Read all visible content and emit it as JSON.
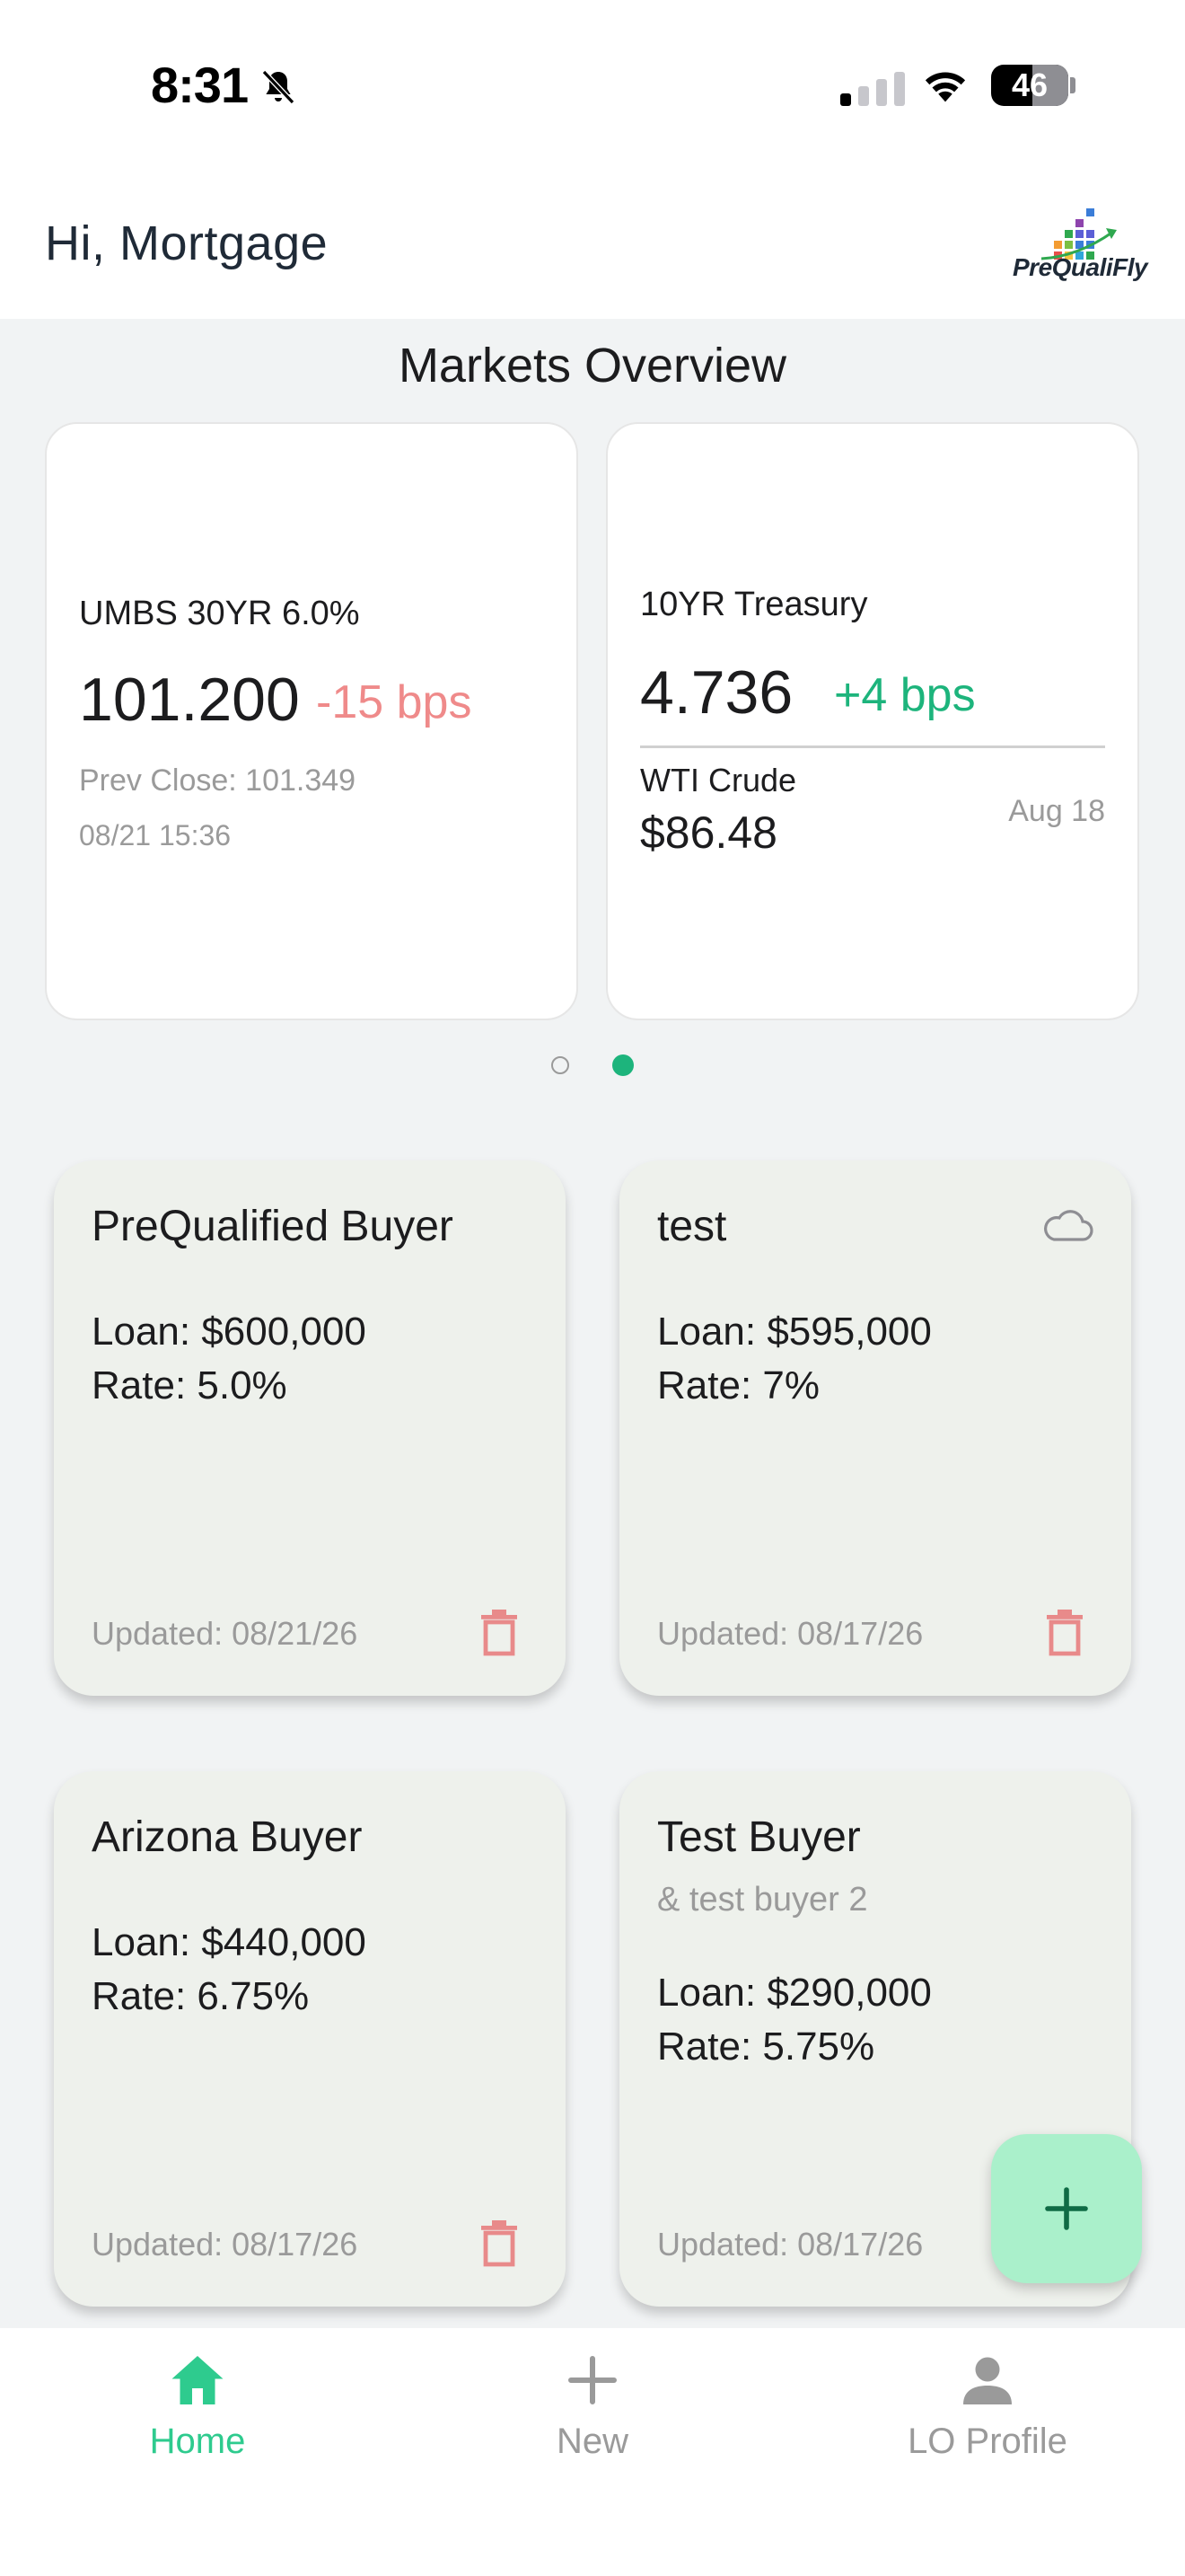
{
  "status_bar": {
    "time": "8:31",
    "battery": "46"
  },
  "header": {
    "greeting": "Hi, Mortgage",
    "logo_text": "PreQualiFly"
  },
  "markets": {
    "title": "Markets Overview",
    "umbs": {
      "label": "UMBS 30YR 6.0%",
      "value": "101.200",
      "change": "-15 bps",
      "prev_close": "Prev Close: 101.349",
      "timestamp": "08/21 15:36"
    },
    "treasury": {
      "label": "10YR Treasury",
      "value": "4.736",
      "change": "+4 bps"
    },
    "crude": {
      "label": "WTI Crude",
      "value": "$86.48",
      "date": "Aug 18"
    },
    "pager": {
      "page_count": 2,
      "current": 2
    }
  },
  "buyers": [
    {
      "name": "PreQualified Buyer",
      "co_buyer": "",
      "loan": "Loan: $600,000",
      "rate": "Rate: 5.0%",
      "updated": "Updated: 08/21/26",
      "cloud": false
    },
    {
      "name": "test",
      "co_buyer": "",
      "loan": "Loan: $595,000",
      "rate": "Rate: 7%",
      "updated": "Updated: 08/17/26",
      "cloud": true
    },
    {
      "name": "Arizona Buyer",
      "co_buyer": "",
      "loan": "Loan: $440,000",
      "rate": "Rate: 6.75%",
      "updated": "Updated: 08/17/26",
      "cloud": false
    },
    {
      "name": "Test Buyer",
      "co_buyer": "& test buyer 2",
      "loan": "Loan: $290,000",
      "rate": "Rate: 5.75%",
      "updated": "Updated: 08/17/26",
      "cloud": false
    }
  ],
  "nav": {
    "home": "Home",
    "new": "New",
    "profile": "LO Profile"
  },
  "colors": {
    "accent": "#2ecb8e",
    "negative": "#ef8a8a",
    "positive": "#1db47c",
    "card_bg": "#eef1ec",
    "trash": "#e88a8a",
    "fab": "#aaf0cb"
  },
  "icons": {
    "status": [
      "bell-slash-icon",
      "cellular-signal-icon",
      "wifi-icon",
      "battery-icon"
    ],
    "cards": [
      "cloud-icon",
      "trash-icon"
    ],
    "fab": "plus-icon",
    "nav": [
      "home-icon",
      "plus-icon",
      "person-icon"
    ]
  }
}
